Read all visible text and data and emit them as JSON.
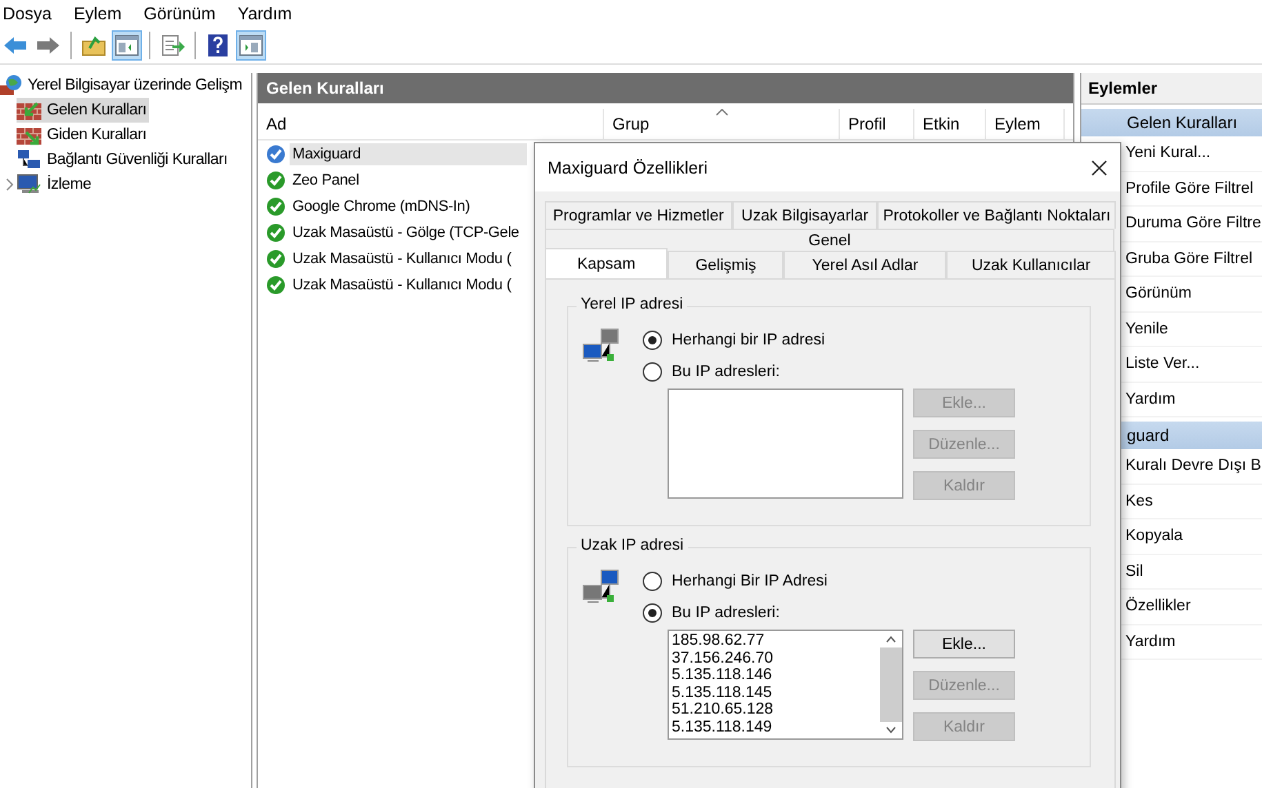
{
  "menu": [
    "Dosya",
    "Eylem",
    "Görünüm",
    "Yardım"
  ],
  "toolbar": [
    {
      "kind": "back",
      "pressed": false
    },
    {
      "kind": "forward",
      "pressed": false
    },
    {
      "kind": "separator"
    },
    {
      "kind": "up",
      "pressed": false
    },
    {
      "kind": "tree",
      "pressed": true
    },
    {
      "kind": "separator"
    },
    {
      "kind": "export",
      "pressed": false
    },
    {
      "kind": "separator"
    },
    {
      "kind": "help",
      "pressed": false
    },
    {
      "kind": "actionpane",
      "pressed": true
    }
  ],
  "tree": {
    "label": "Yerel Bilgisayar üzerinde Gelişm",
    "children": [
      {
        "label": "Gelen Kuralları",
        "kind": "inbound",
        "selected": true
      },
      {
        "label": "Giden Kuralları",
        "kind": "outbound",
        "selected": false
      },
      {
        "label": "Bağlantı Güvenliği Kuralları",
        "kind": "security",
        "selected": false
      },
      {
        "label": "İzleme",
        "kind": "monitor",
        "selected": false,
        "expanded": false
      }
    ]
  },
  "main": {
    "title": "Gelen Kuralları",
    "columns": [
      {
        "label": "Ad",
        "sorted": false
      },
      {
        "label": "Grup",
        "sorted": true
      },
      {
        "label": "Profil",
        "sorted": false
      },
      {
        "label": "Etkin",
        "sorted": false
      },
      {
        "label": "Eylem",
        "sorted": false
      }
    ],
    "rows": [
      {
        "name": "Maxiguard",
        "selected": true
      },
      {
        "name": "Zeo Panel",
        "selected": false
      },
      {
        "name": "Google Chrome (mDNS-In)",
        "selected": false
      },
      {
        "name": "Uzak Masaüstü - Gölge (TCP-Gele",
        "selected": false
      },
      {
        "name": "Uzak Masaüstü - Kullanıcı Modu (",
        "selected": false
      },
      {
        "name": "Uzak Masaüstü - Kullanıcı Modu (",
        "selected": false
      }
    ]
  },
  "actions": {
    "title": "Eylemler",
    "sections": [
      {
        "title": "Gelen Kuralları",
        "items": [
          "Yeni Kural...",
          "Profile Göre Filtrel",
          "Duruma Göre Filtre",
          "Gruba Göre Filtrel",
          "Görünüm",
          "Yenile",
          "Liste Ver...",
          "Yardım"
        ]
      },
      {
        "title": "guard",
        "items": [
          "Kuralı Devre Dışı B",
          "Kes",
          "Kopyala",
          "Sil",
          "Özellikler",
          "Yardım"
        ]
      }
    ]
  },
  "dialog": {
    "title": "Maxiguard Özellikleri",
    "tab_rows": [
      [
        {
          "label": "Programlar ve Hizmetler",
          "selected": false
        },
        {
          "label": "Uzak Bilgisayarlar",
          "selected": false
        },
        {
          "label": "Protokoller ve Bağlantı Noktaları",
          "selected": false
        }
      ],
      [
        {
          "label": "Genel",
          "selected": false
        }
      ],
      [
        {
          "label": "Kapsam",
          "selected": true
        },
        {
          "label": "Gelişmiş",
          "selected": false
        },
        {
          "label": "Yerel Asıl Adlar",
          "selected": false
        },
        {
          "label": "Uzak Kullanıcılar",
          "selected": false
        }
      ]
    ],
    "groups": [
      {
        "title": "Yerel IP adresi",
        "options": [
          {
            "label": "Herhangi bir IP adresi",
            "selected": true
          },
          {
            "label": "Bu IP adresleri:",
            "selected": false
          }
        ],
        "buttons": [
          {
            "label": "Ekle...",
            "disabled": true
          },
          {
            "label": "Düzenle...",
            "disabled": true
          },
          {
            "label": "Kaldır",
            "disabled": true
          }
        ]
      },
      {
        "title": "Uzak IP adresi",
        "options": [
          {
            "label": "Herhangi Bir IP Adresi",
            "selected": false
          },
          {
            "label": "Bu IP adresleri:",
            "selected": true
          }
        ],
        "addresses": [
          "185.98.62.77",
          "37.156.246.70",
          "5.135.118.146",
          "5.135.118.145",
          "51.210.65.128",
          "5.135.118.149"
        ],
        "buttons": [
          {
            "label": "Ekle...",
            "disabled": false
          },
          {
            "label": "Düzenle...",
            "disabled": true
          },
          {
            "label": "Kaldır",
            "disabled": true
          }
        ]
      }
    ]
  }
}
